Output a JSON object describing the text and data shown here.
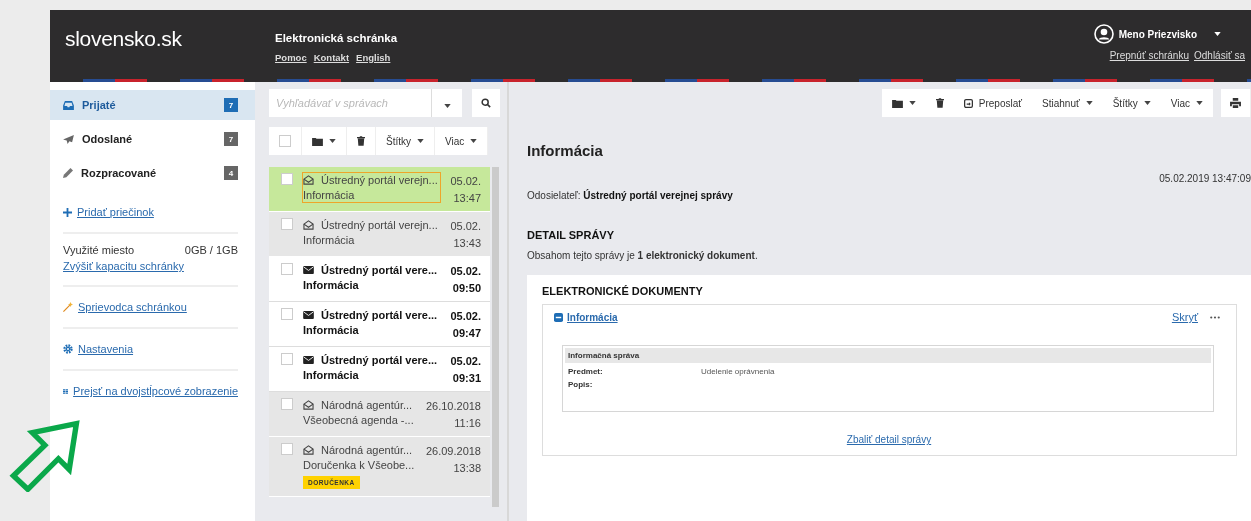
{
  "header": {
    "logo": "slovensko.sk",
    "title": "Elektronická schránka",
    "links": [
      "Pomoc",
      "Kontakt",
      "English"
    ],
    "user": "Meno Priezvisko",
    "user_links": [
      "Prepnúť schránku",
      "Odhlásiť sa"
    ]
  },
  "sidebar": {
    "folders": [
      {
        "kind": "inbox",
        "label": "Prijaté",
        "count": "7",
        "selected": true
      },
      {
        "kind": "sent",
        "label": "Odoslané",
        "count": "7",
        "selected": false
      },
      {
        "kind": "drafts",
        "label": "Rozpracované",
        "count": "4",
        "selected": false
      }
    ],
    "add_folder": "Pridať priečinok",
    "storage": {
      "label": "Využité miesto",
      "value": "0GB / 1GB",
      "link": "Zvýšiť kapacitu schránky"
    },
    "links": [
      {
        "kind": "guide",
        "label": "Sprievodca schránkou"
      },
      {
        "kind": "settings",
        "label": "Nastavenia"
      },
      {
        "kind": "columns",
        "label": "Prejsť na dvojstĺpcové zobrazenie"
      }
    ]
  },
  "list": {
    "search": {
      "placeholder": "Vyhľadávať v správach"
    },
    "toolbar": [
      {
        "kind": "checkbox",
        "checked": false
      },
      {
        "kind": "folder",
        "caret": true
      },
      {
        "kind": "trash",
        "caret": false
      },
      {
        "kind": "text",
        "label": "Štítky",
        "caret": true
      },
      {
        "kind": "text",
        "label": "Viac",
        "caret": true
      }
    ],
    "messages": [
      {
        "sender": "Ústredný portál verejn...",
        "subject": "Informácia",
        "date": "05.02.",
        "time": "13:47",
        "read": true,
        "selected": true,
        "checked": false
      },
      {
        "sender": "Ústredný portál verejn...",
        "subject": "Informácia",
        "date": "05.02.",
        "time": "13:43",
        "read": true,
        "selected": false,
        "checked": false
      },
      {
        "sender": "Ústredný portál vere...",
        "subject": "Informácia",
        "date": "05.02.",
        "time": "09:50",
        "read": false,
        "selected": false,
        "checked": false
      },
      {
        "sender": "Ústredný portál vere...",
        "subject": "Informácia",
        "date": "05.02.",
        "time": "09:47",
        "read": false,
        "selected": false,
        "checked": false
      },
      {
        "sender": "Ústredný portál vere...",
        "subject": "Informácia",
        "date": "05.02.",
        "time": "09:31",
        "read": false,
        "selected": false,
        "checked": false
      },
      {
        "sender": "Národná agentúr...",
        "subject": "Všeobecná agenda -...",
        "date": "26.10.2018",
        "time": "11:16",
        "read": true,
        "selected": false,
        "checked": false
      },
      {
        "sender": "Národná agentúr...",
        "subject": "Doručenka k Všeobe...",
        "date": "26.09.2018",
        "time": "13:38",
        "read": true,
        "selected": false,
        "checked": false,
        "tag": "DORUČENKA"
      }
    ]
  },
  "detail": {
    "toolbar": [
      {
        "kind": "folder",
        "caret": true
      },
      {
        "kind": "trash",
        "caret": false
      },
      {
        "kind": "forward",
        "label": "Preposlať",
        "caret": false
      },
      {
        "kind": "text",
        "label": "Stiahnuť",
        "caret": true
      },
      {
        "kind": "text",
        "label": "Štítky",
        "caret": true
      },
      {
        "kind": "text",
        "label": "Viac",
        "caret": true
      }
    ],
    "title": "Informácia",
    "datetime": "05.02.2019 13:47:09",
    "sender_label": "Odosielateľ:",
    "sender": "Ústredný portál verejnej správy",
    "section_heading": "DETAIL SPRÁVY",
    "summary": "Obsahom tejto správy je **1 elektronický dokument**.",
    "documents": {
      "heading": "ELEKTRONICKÉ DOKUMENTY",
      "doc_title": "Informácia",
      "hide_link": "Skryť",
      "form": {
        "title": "Informačná správa",
        "rows": [
          {
            "label": "Predmet:",
            "value": "Udelenie oprávnenia"
          },
          {
            "label": "Popis:"
          }
        ]
      }
    },
    "collapse_link": "Zbaliť detail správy"
  }
}
